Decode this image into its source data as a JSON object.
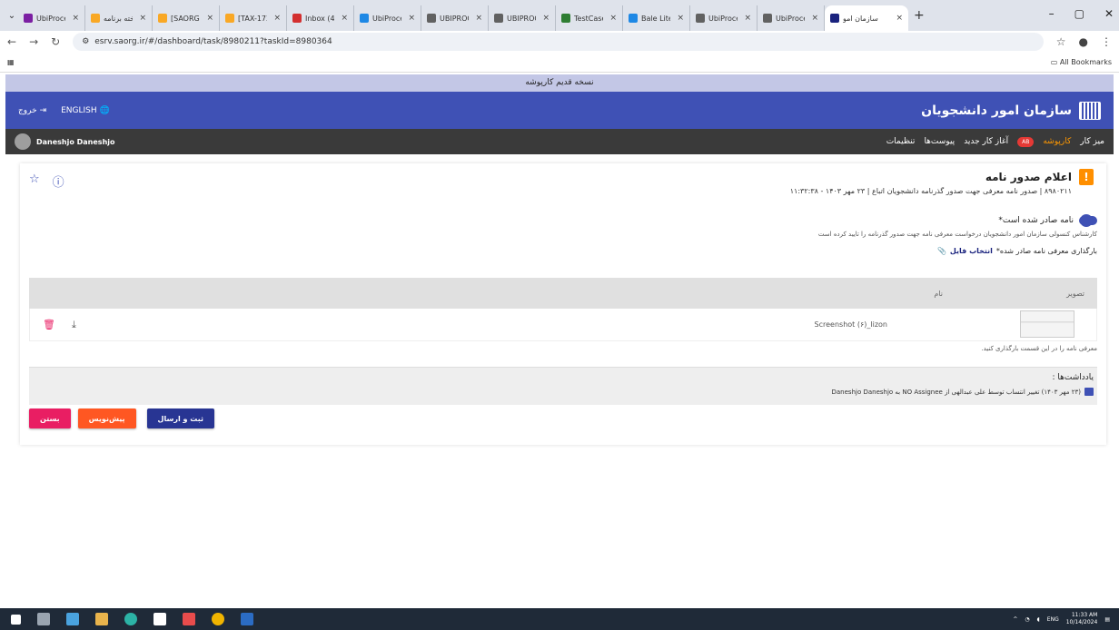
{
  "browser": {
    "tabs": [
      {
        "label": "UbiProces",
        "color": "#7b1fa2"
      },
      {
        "label": "تخته برنامه",
        "color": "#f9a825"
      },
      {
        "label": "[SAORG-4",
        "color": "#f9a825"
      },
      {
        "label": "[TAX-172]",
        "color": "#f9a825"
      },
      {
        "label": "Inbox (48)",
        "color": "#d32f2f"
      },
      {
        "label": "UbiProces",
        "color": "#1e88e5"
      },
      {
        "label": "UBIPROCE",
        "color": "#616161"
      },
      {
        "label": "UBIPROCE",
        "color": "#616161"
      },
      {
        "label": "TestCase",
        "color": "#2e7d32"
      },
      {
        "label": "Bale Lite",
        "color": "#1e88e5"
      },
      {
        "label": "UbiProces",
        "color": "#616161"
      },
      {
        "label": "UbiProces",
        "color": "#616161"
      },
      {
        "label": "سازمان امو",
        "color": "#1a237e"
      }
    ],
    "url": "esrv.saorg.ir/#/dashboard/task/8980211?taskId=8980364",
    "bookmarks_label": "All Bookmarks"
  },
  "page": {
    "old_version": "نسخه قدیم کارپوشه",
    "org_name": "سازمان امور دانشجویان",
    "language": "ENGLISH",
    "logout": "خروج",
    "user_name": "Daneshjo Daneshjo",
    "menu": {
      "desk": "میز کار",
      "folder": "کارپوشه",
      "folder_badge": "AB",
      "new_task": "آغاز کار جدید",
      "attachments": "پیوست‌ها",
      "settings": "تنظیمات"
    }
  },
  "task": {
    "title": "اعلام صدور نامه",
    "subtitle": "۸۹۸۰۲۱۱ | صدور نامه معرفی جهت صدور گذرنامه دانشجویان اتباع | ۲۳ مهر ۱۴۰۳ - ۱۱:۳۲:۳۸",
    "toggle_label": "نامه صادر شده است*",
    "hint": "کارشناس کنسولی سازمان امور دانشجویان درخواست معرفی نامه جهت صدور گذرنامه را تایید کرده است",
    "upload_label": "بارگذاری معرفی نامه صادر شده*",
    "upload_link": "انتخاب فایل",
    "table_headers": {
      "image": "تصویر",
      "name": "نام"
    },
    "file_name": "Screenshot (۶)_lizon",
    "table_note": "معرفی نامه را در این قسمت بارگذاری کنید.",
    "notes_title": "یادداشت‌ها :",
    "note_text": "(۲۳ مهر ۱۴۰۳) تغییر انتساب توسط علی عبدالهی از NO Assignee به Daneshjo Daneshjo",
    "buttons": {
      "submit": "ثبت و ارسال",
      "draft": "پیش‌نویس",
      "close": "بستن"
    }
  },
  "taskbar": {
    "time": "11:33 AM",
    "date": "10/14/2024",
    "lang": "ENG"
  },
  "colors": {
    "header": "#3f51b5",
    "usernav": "#3a3a3a",
    "accent": "#ff9800"
  }
}
